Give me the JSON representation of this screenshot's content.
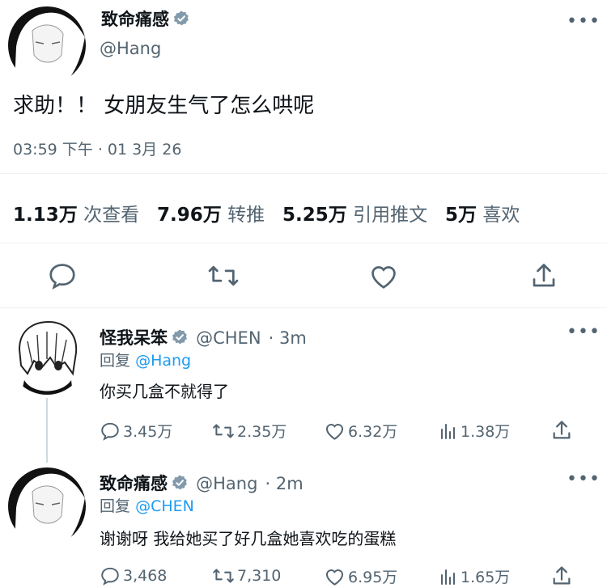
{
  "main_tweet": {
    "author": {
      "name": "致命痛感",
      "handle": "@Hang"
    },
    "text": "求助！！ 女朋友生气了怎么哄呢",
    "timestamp": "03:59 下午 · 01 3月 26",
    "stats": {
      "views": {
        "value": "1.13万",
        "label": "次查看"
      },
      "retweets": {
        "value": "7.96万",
        "label": "转推"
      },
      "quotes": {
        "value": "5.25万",
        "label": "引用推文"
      },
      "likes": {
        "value": "5万",
        "label": "喜欢"
      }
    },
    "more_glyph": "•••"
  },
  "replies": [
    {
      "name": "怪我呆笨",
      "handle": "@CHEN",
      "time": "· 3m",
      "reply_prefix": "回复",
      "reply_to": "@Hang",
      "text": "你买几盒不就得了",
      "counts": {
        "reply": "3.45万",
        "retweet": "2.35万",
        "like": "6.32万",
        "views": "1.38万"
      },
      "more_glyph": "•••"
    },
    {
      "name": "致命痛感",
      "handle": "@Hang",
      "time": "· 2m",
      "reply_prefix": "回复",
      "reply_to": "@CHEN",
      "text": "谢谢呀 我给她买了好几盒她喜欢吃的蛋糕",
      "counts": {
        "reply": "3,468",
        "retweet": "7,310",
        "like": "6.95万",
        "views": "1.65万"
      },
      "more_glyph": "•••"
    }
  ],
  "colors": {
    "accent": "#1d9bf0",
    "secondary_text": "#536471",
    "divider": "#eff3f4"
  }
}
